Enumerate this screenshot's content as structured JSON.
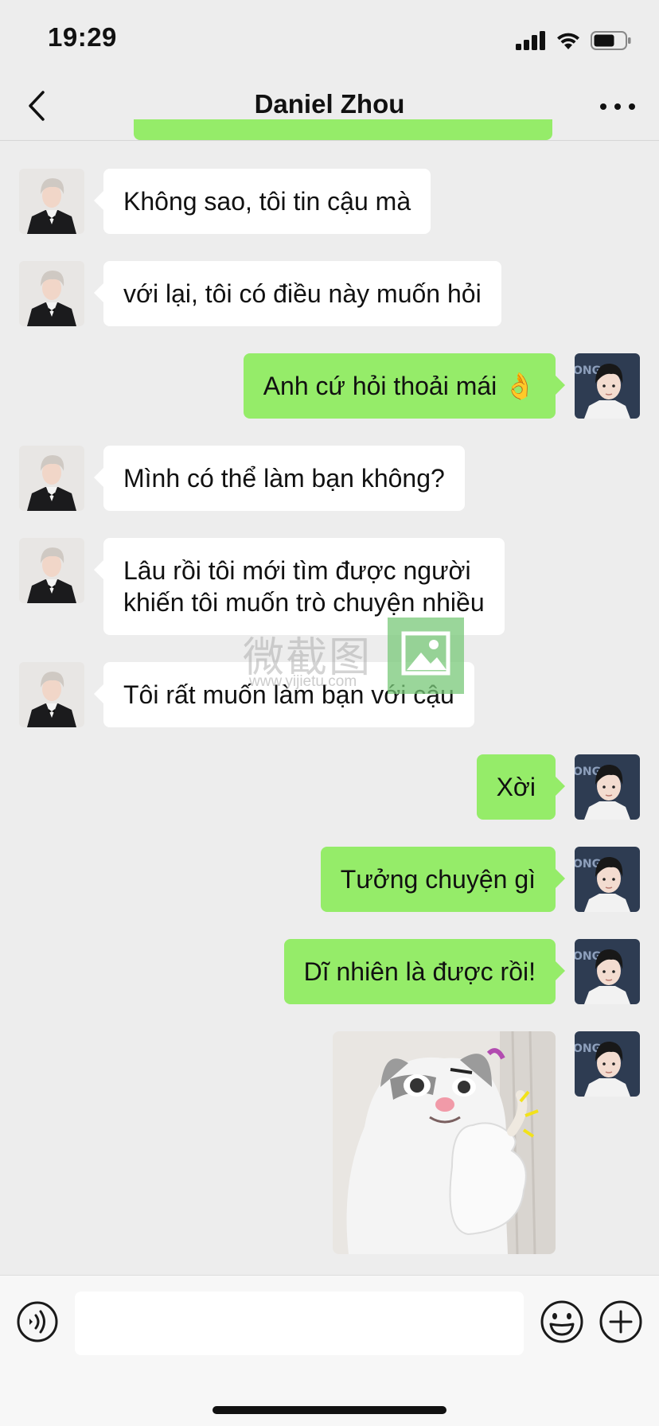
{
  "status_bar": {
    "time": "19:29",
    "signal_icon": "cellular-signal-icon",
    "wifi_icon": "wifi-icon",
    "battery_icon": "battery-icon"
  },
  "nav": {
    "title": "Daniel Zhou",
    "back_icon": "chevron-left-icon",
    "more_icon": "more-dots-icon"
  },
  "messages": [
    {
      "side": "left",
      "lines": [
        "Không sao, tôi tin cậu mà"
      ]
    },
    {
      "side": "left",
      "lines": [
        "với lại, tôi có điều này muốn hỏi"
      ]
    },
    {
      "side": "right",
      "lines": [
        "Anh cứ hỏi thoải mái 👌"
      ]
    },
    {
      "side": "left",
      "lines": [
        "Mình có thể làm bạn không?"
      ]
    },
    {
      "side": "left",
      "lines": [
        "Lâu rồi tôi mới tìm được người",
        "khiến tôi muốn trò chuyện nhiều"
      ]
    },
    {
      "side": "left",
      "lines": [
        "Tôi rất muốn làm bạn với cậu"
      ]
    },
    {
      "side": "right",
      "lines": [
        "Xời"
      ]
    },
    {
      "side": "right",
      "lines": [
        "Tưởng chuyện gì"
      ]
    },
    {
      "side": "right",
      "lines": [
        "Dĩ nhiên là được rồi!"
      ]
    },
    {
      "side": "right",
      "sticker": "cat-thumbs-up-sticker"
    }
  ],
  "watermark": {
    "text": "微截图",
    "url": "www.yijietu.com"
  },
  "input_bar": {
    "placeholder": "",
    "voice_icon": "voice-icon",
    "emoji_icon": "emoji-icon",
    "plus_icon": "plus-icon"
  },
  "colors": {
    "background": "#ededed",
    "sent_bubble": "#95ec69",
    "received_bubble": "#ffffff"
  }
}
